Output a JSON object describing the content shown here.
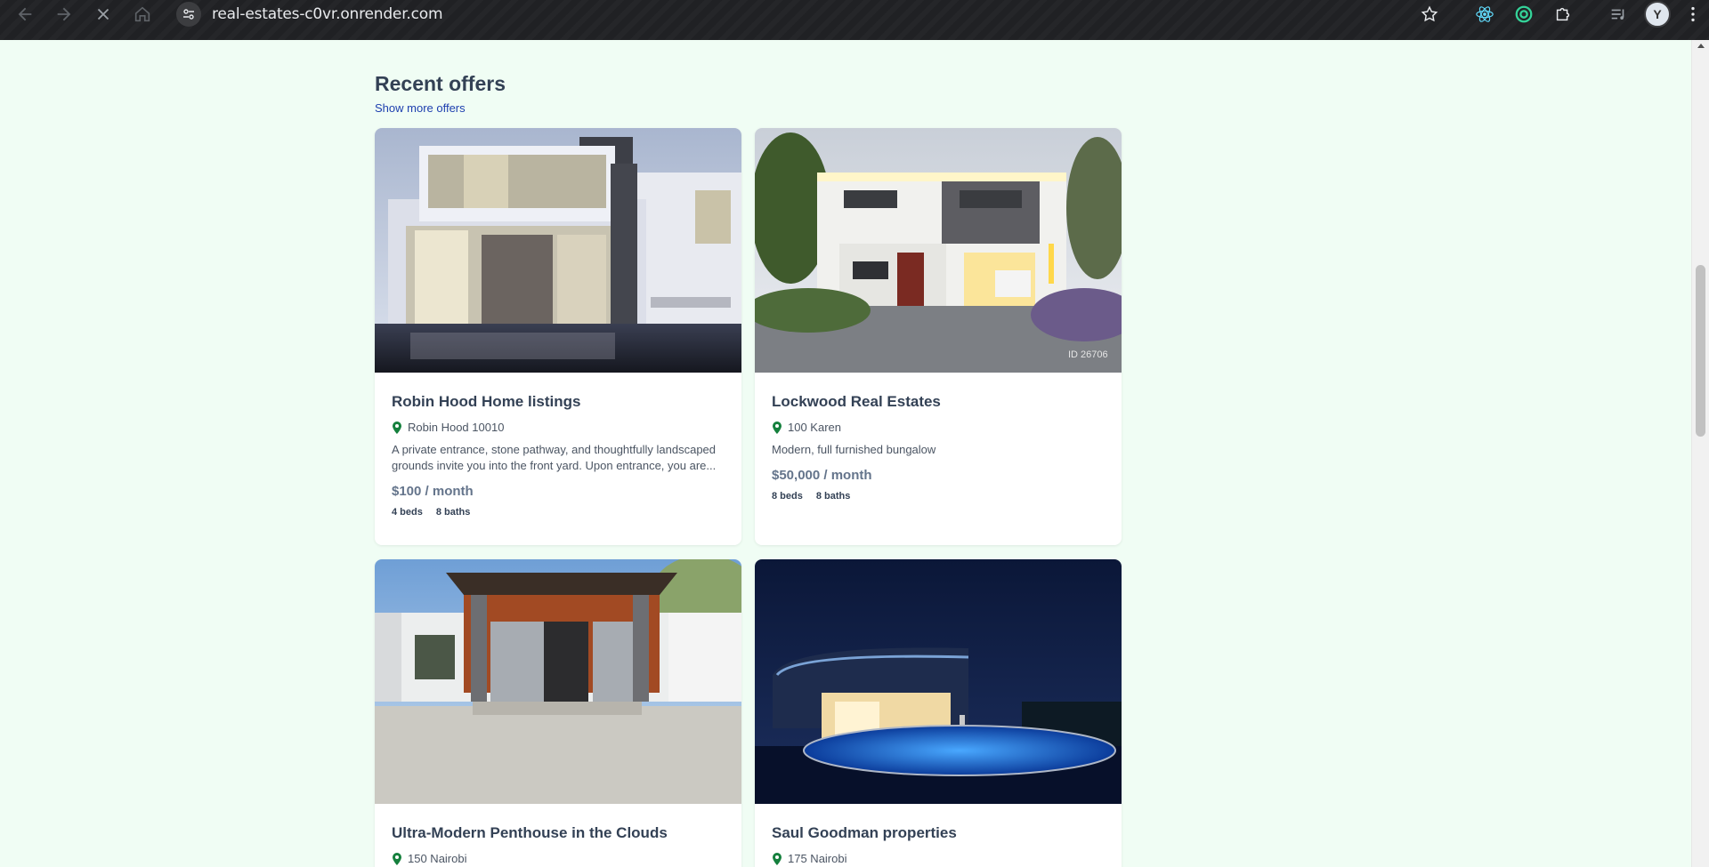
{
  "browser": {
    "url": "real-estates-c0vr.onrender.com",
    "avatar_initial": "Y"
  },
  "section": {
    "title": "Recent offers",
    "show_more": "Show more offers"
  },
  "listings": [
    {
      "title": "Robin Hood Home listings",
      "location": "Robin Hood 10010",
      "description": "A private entrance, stone pathway, and thoughtfully landscaped grounds invite you into the front yard. Upon entrance, you are...",
      "price": "$100 / month",
      "beds": "4 beds",
      "baths": "8 baths",
      "image": "modern-white-villa-photo"
    },
    {
      "title": "Lockwood Real Estates",
      "location": "100 Karen",
      "description": "Modern, full furnished bungalow",
      "price": "$50,000 / month",
      "beds": "8 beds",
      "baths": "8 baths",
      "image": "modern-house-dusk-photo",
      "image_watermark": "ID 26706"
    },
    {
      "title": "Ultra-Modern Penthouse in the Clouds",
      "location": "150 Nairobi",
      "image": "wood-facade-house-photo"
    },
    {
      "title": "Saul Goodman properties",
      "location": "175 Nairobi",
      "image": "night-villa-pool-photo"
    }
  ],
  "colors": {
    "page_background": "#f0fdf4",
    "pin_green": "#15803d",
    "link_blue": "#1e40af"
  }
}
